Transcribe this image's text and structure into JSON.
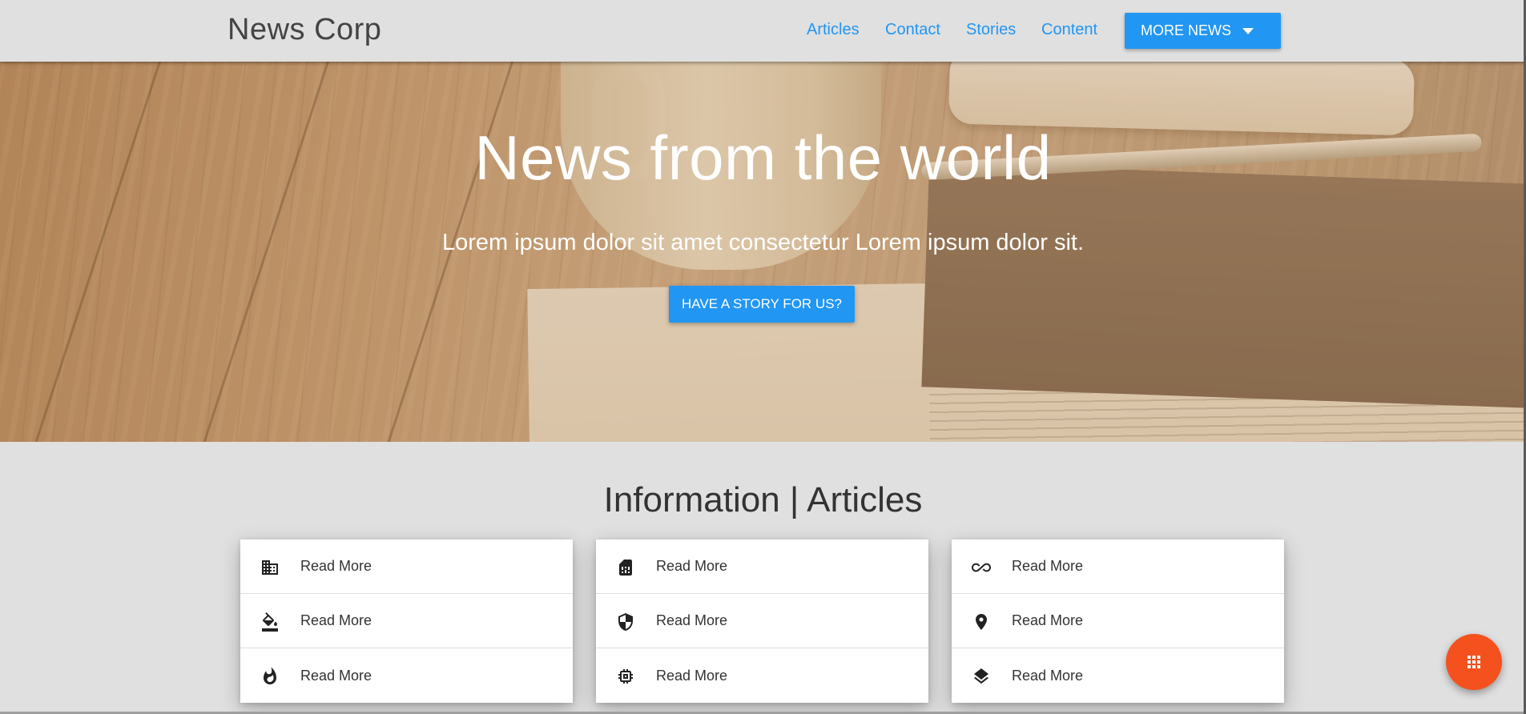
{
  "header": {
    "brand": "News Corp",
    "nav": [
      "Articles",
      "Contact",
      "Stories",
      "Content"
    ],
    "more_button": "MORE NEWS"
  },
  "hero": {
    "title": "News from the world",
    "subtitle": "Lorem ipsum dolor sit amet consectetur Lorem ipsum dolor sit.",
    "cta": "HAVE A STORY FOR US?"
  },
  "section": {
    "title": "Information | Articles"
  },
  "cards": [
    {
      "items": [
        {
          "icon": "building-icon",
          "label": "Read More"
        },
        {
          "icon": "paint-bucket-icon",
          "label": "Read More"
        },
        {
          "icon": "flame-icon",
          "label": "Read More"
        }
      ]
    },
    {
      "items": [
        {
          "icon": "sim-card-icon",
          "label": "Read More"
        },
        {
          "icon": "shield-icon",
          "label": "Read More"
        },
        {
          "icon": "chip-icon",
          "label": "Read More"
        }
      ]
    },
    {
      "items": [
        {
          "icon": "infinity-icon",
          "label": "Read More"
        },
        {
          "icon": "location-pin-icon",
          "label": "Read More"
        },
        {
          "icon": "layers-icon",
          "label": "Read More"
        }
      ]
    }
  ],
  "fab": {
    "icon": "apps-grid-icon"
  },
  "colors": {
    "accent": "#2196f3",
    "fab": "#f4511e",
    "background": "#e0e0e0"
  }
}
